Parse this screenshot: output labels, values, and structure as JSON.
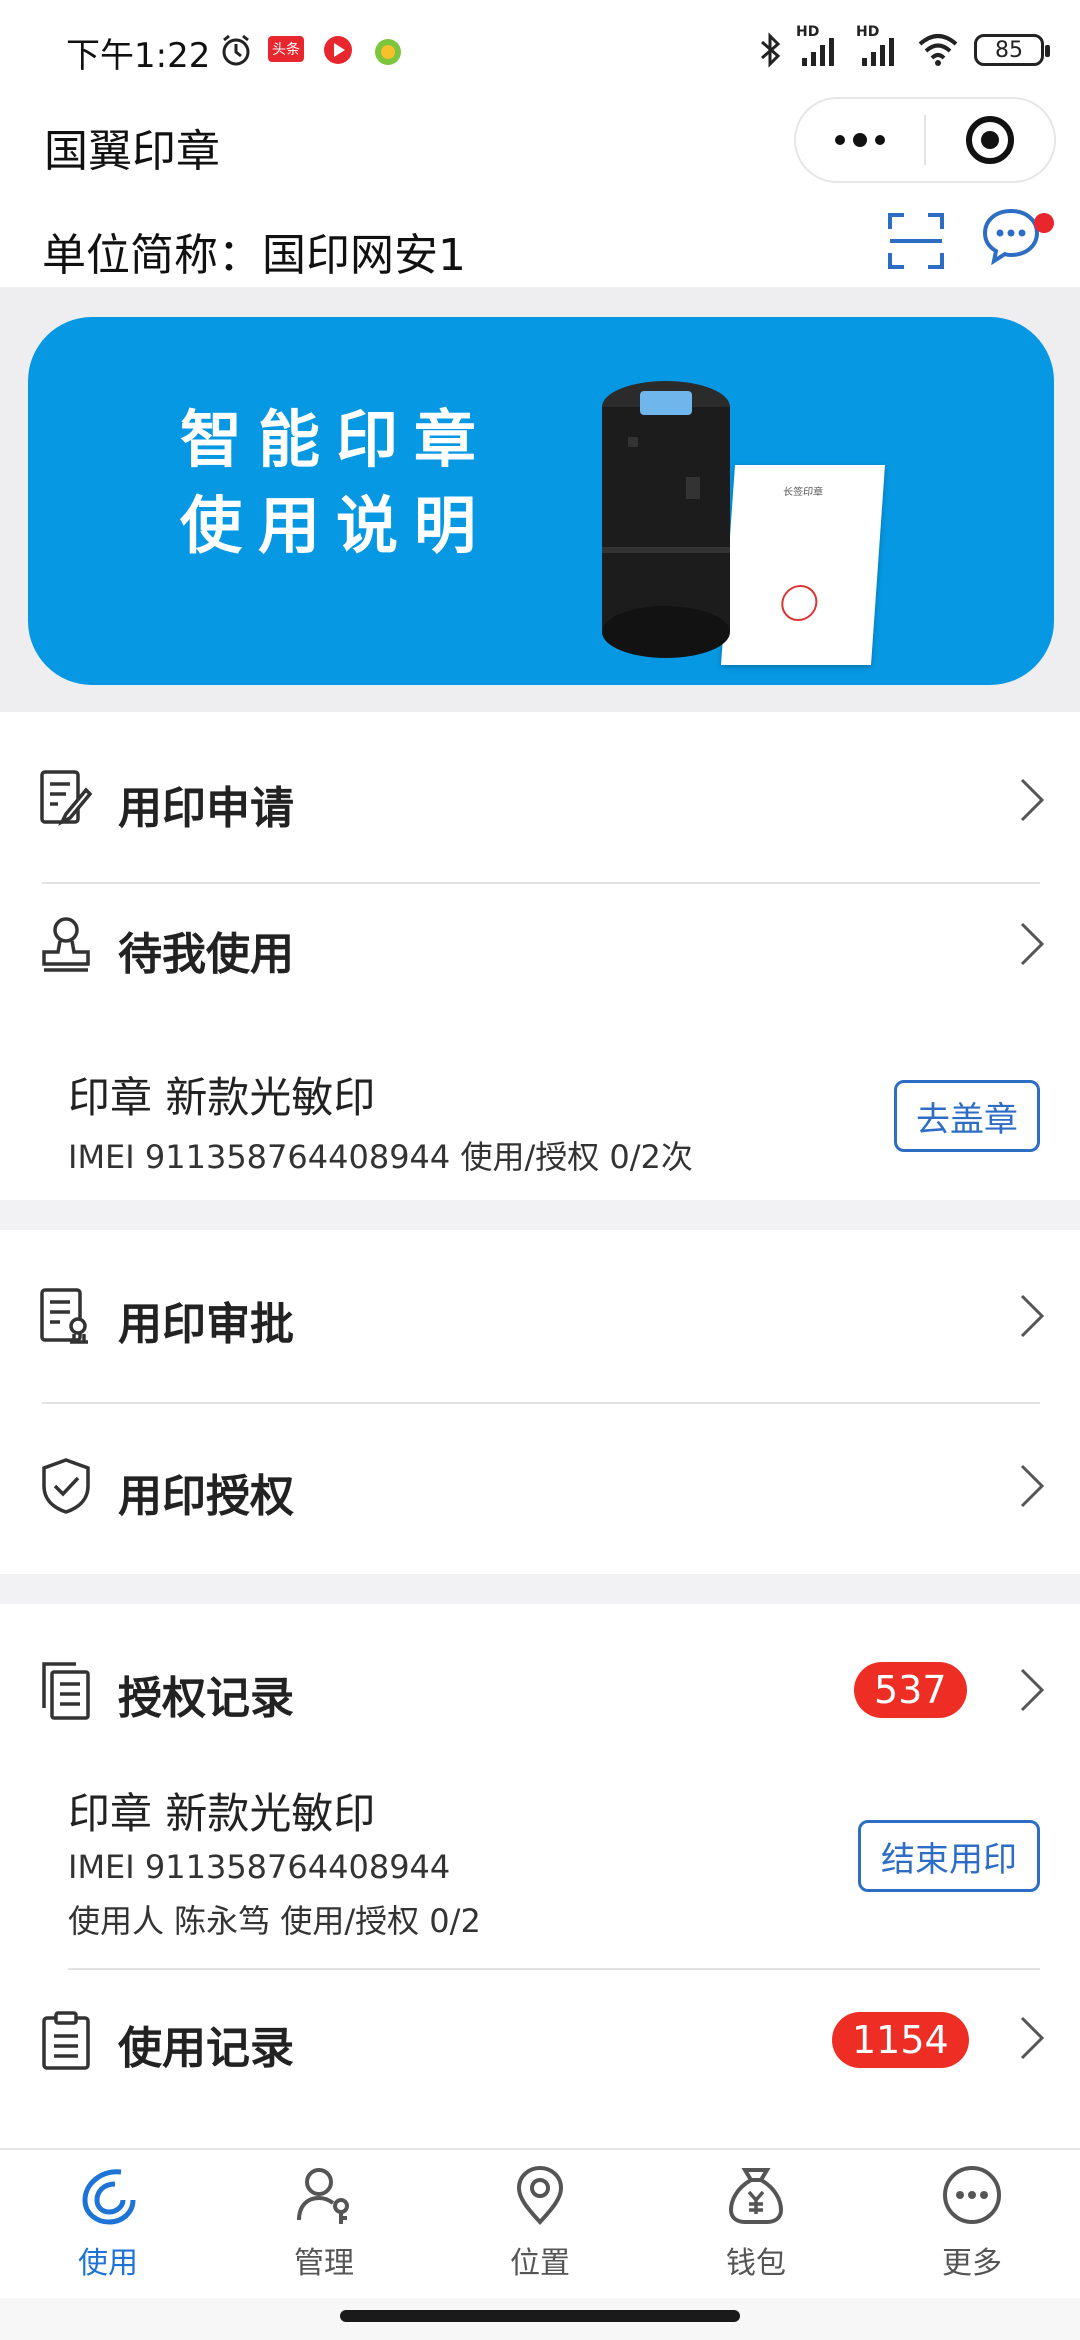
{
  "status_bar": {
    "time": "下午1:22",
    "notification_badge": "头条",
    "signal_label_1": "HD",
    "signal_label_2": "HD",
    "battery": "85"
  },
  "app": {
    "title": "国翼印章"
  },
  "header": {
    "unit_label": "单位简称：国印网安1"
  },
  "banner": {
    "line1": "智能印章",
    "line2": "使用说明",
    "paper_title": "长签印章"
  },
  "menu": {
    "apply_label": "用印申请",
    "pending_label": "待我使用",
    "approve_label": "用印审批",
    "authorize_label": "用印授权",
    "auth_records_label": "授权记录",
    "auth_records_count": "537",
    "usage_records_label": "使用记录",
    "usage_records_count": "1154"
  },
  "pending_item": {
    "title": "印章 新款光敏印",
    "detail": "IMEI 911358764408944 使用/授权 0/2次",
    "action": "去盖章"
  },
  "auth_item": {
    "title": "印章 新款光敏印",
    "imei": "IMEI 911358764408944",
    "detail": "使用人 陈永笃 使用/授权 0/2",
    "action": "结束用印"
  },
  "bottom_nav": {
    "items": [
      {
        "label": "使用",
        "icon": "use-icon",
        "active": true
      },
      {
        "label": "管理",
        "icon": "manage-icon",
        "active": false
      },
      {
        "label": "位置",
        "icon": "location-icon",
        "active": false
      },
      {
        "label": "钱包",
        "icon": "wallet-icon",
        "active": false
      },
      {
        "label": "更多",
        "icon": "more-icon",
        "active": false
      }
    ]
  },
  "colors": {
    "accent": "#1d73d6",
    "banner": "#0698e3",
    "badge": "#ee2e24"
  }
}
